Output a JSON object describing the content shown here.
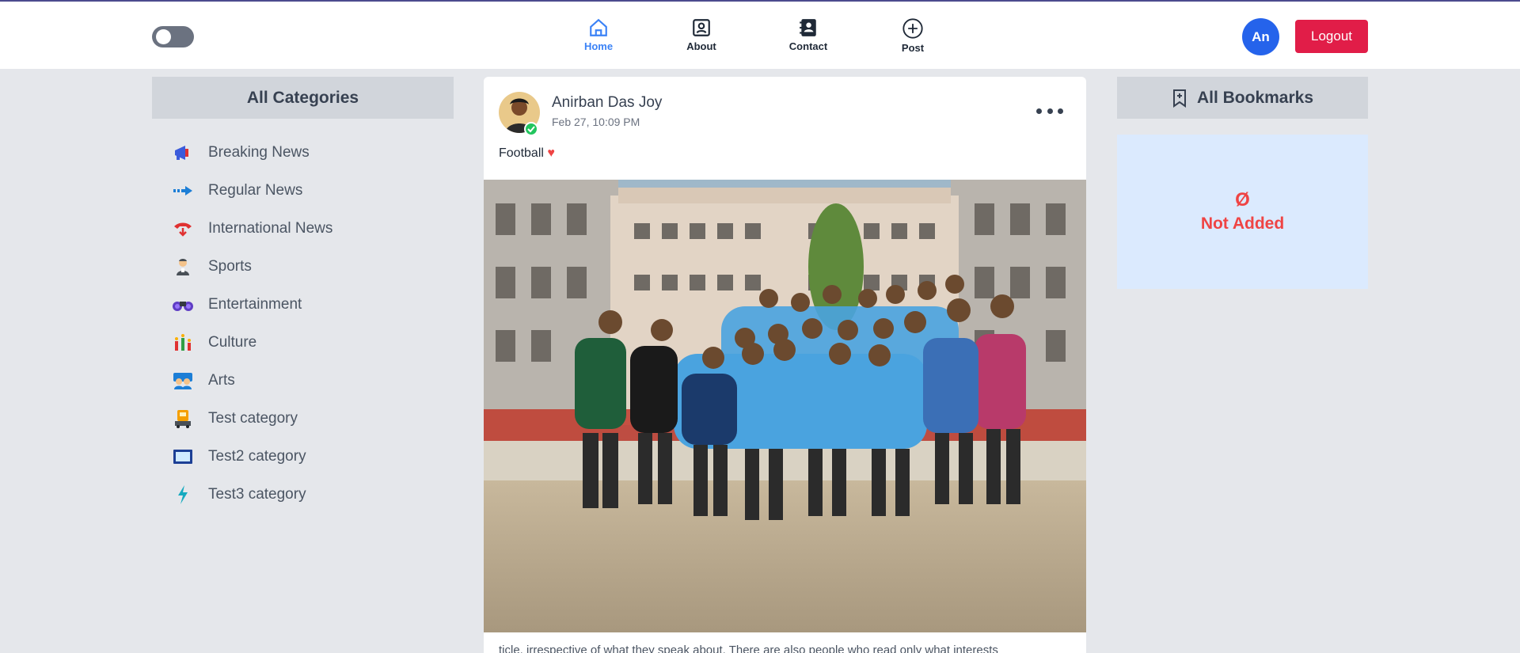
{
  "nav": {
    "items": [
      {
        "label": "Home",
        "icon": "home-icon",
        "active": true
      },
      {
        "label": "About",
        "icon": "about-icon",
        "active": false
      },
      {
        "label": "Contact",
        "icon": "contact-icon",
        "active": false
      },
      {
        "label": "Post",
        "icon": "plus-circle-icon",
        "active": false
      }
    ],
    "avatar_initials": "An",
    "logout_label": "Logout"
  },
  "categories": {
    "title": "All Categories",
    "items": [
      {
        "label": "Breaking News",
        "icon": "megaphone-icon"
      },
      {
        "label": "Regular News",
        "icon": "arrow-right-icon"
      },
      {
        "label": "International News",
        "icon": "phone-down-icon"
      },
      {
        "label": "Sports",
        "icon": "person-icon"
      },
      {
        "label": "Entertainment",
        "icon": "binoculars-icon"
      },
      {
        "label": "Culture",
        "icon": "candles-icon"
      },
      {
        "label": "Arts",
        "icon": "people-icon"
      },
      {
        "label": "Test category",
        "icon": "machine-icon"
      },
      {
        "label": "Test2 category",
        "icon": "monitor-icon"
      },
      {
        "label": "Test3 category",
        "icon": "lightning-icon"
      }
    ]
  },
  "post": {
    "author": "Anirban Das Joy",
    "time": "Feb 27, 10:09 PM",
    "caption": "Football",
    "caption_emoji": "♥",
    "body": "ticle, irrespective of what they speak about. There are also people who read only what interests"
  },
  "bookmarks": {
    "title": "All Bookmarks",
    "empty_icon": "Ø",
    "empty_label": "Not Added"
  },
  "colors": {
    "accent": "#3b82f6",
    "logout": "#e11d48",
    "avatar": "#2563eb",
    "empty_text": "#ef4444"
  }
}
